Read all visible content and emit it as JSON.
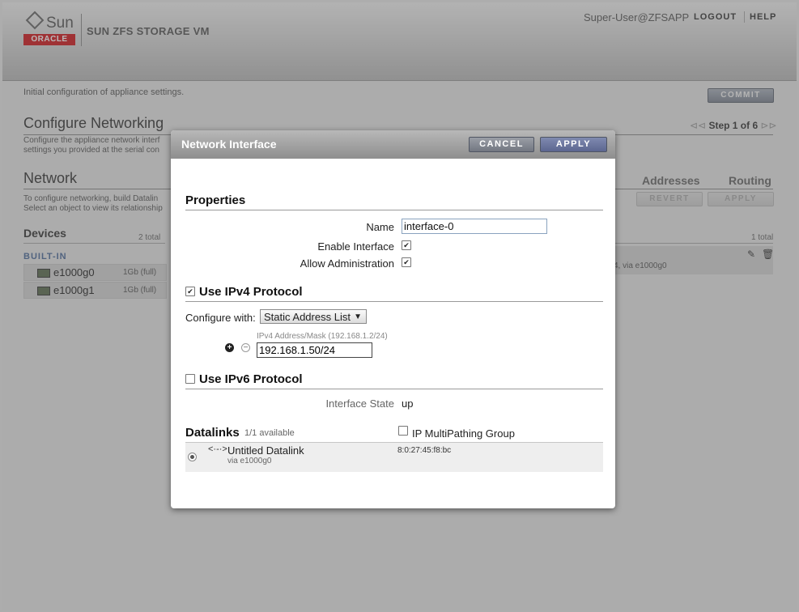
{
  "header": {
    "brand_sun": "Sun",
    "brand_oracle": "ORACLE",
    "product": "SUN ZFS STORAGE VM",
    "user": "Super-User@ZFSAPP",
    "logout": "LOGOUT",
    "help": "HELP"
  },
  "page": {
    "intro": "Initial configuration of appliance settings.",
    "commit": "COMMIT",
    "configure_title": "Configure Networking",
    "configure_desc_1": "Configure the appliance network interf",
    "configure_desc_2": "settings you provided at the serial con",
    "step": "Step 1 of 6",
    "network_title": "Network",
    "network_desc_1": "To configure networking, build Datalin",
    "network_desc_2": "Select an object to view its relationship",
    "devices_title": "Devices",
    "devices_total": "2 total",
    "builtin": "BUILT-IN",
    "devices": [
      {
        "name": "e1000g0",
        "speed": "1Gb (full)"
      },
      {
        "name": "e1000g1",
        "speed": "1Gb (full)"
      }
    ],
    "tab_addresses": "Addresses",
    "tab_routing": "Routing",
    "revert": "REVERT",
    "apply": "APPLY",
    "right_total": "1 total",
    "right_row_text": "4, via e1000g0"
  },
  "dialog": {
    "title": "Network Interface",
    "cancel": "CANCEL",
    "apply": "APPLY",
    "properties": "Properties",
    "name_label": "Name",
    "name_value": "interface-0",
    "enable_label": "Enable Interface",
    "enable_checked": true,
    "allow_admin_label": "Allow Administration",
    "allow_admin_checked": true,
    "ipv4_label": "Use IPv4 Protocol",
    "ipv4_checked": true,
    "configure_with_label": "Configure with:",
    "configure_with_value": "Static Address List",
    "ipv4_hint": "IPv4 Address/Mask (192.168.1.2/24)",
    "ipv4_value": "192.168.1.50/24",
    "ipv6_label": "Use IPv6 Protocol",
    "ipv6_checked": false,
    "state_label": "Interface State",
    "state_value": "up",
    "datalinks_title": "Datalinks",
    "datalinks_available": "1/1 available",
    "ipmp_label": "IP MultiPathing Group",
    "ipmp_checked": false,
    "datalink": {
      "name": "Untitled Datalink",
      "via": "via e1000g0",
      "mac": "8:0:27:45:f8:bc"
    }
  }
}
